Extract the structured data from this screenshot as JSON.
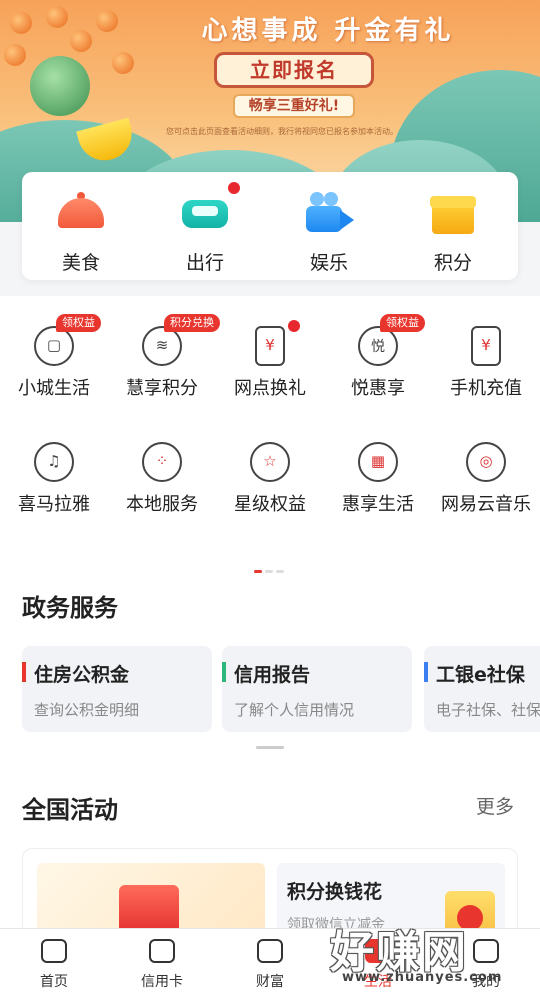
{
  "banner": {
    "title": "心想事成 升金有礼",
    "button": "立即报名",
    "subtitle": "畅享三重好礼!",
    "note": "您可点击此页面查看活动细则，我行将视同您已报名参加本活动。"
  },
  "categories": [
    {
      "label": "美食",
      "icon": "food-dome-icon",
      "color": "#f15a3b"
    },
    {
      "label": "出行",
      "icon": "car-icon",
      "color": "#12b3a6",
      "dot": true
    },
    {
      "label": "娱乐",
      "icon": "video-camera-icon",
      "color": "#1e88f0"
    },
    {
      "label": "积分",
      "icon": "gift-box-icon",
      "color": "#f6aa12"
    }
  ],
  "services": [
    {
      "label": "小城生活",
      "tag": "领权益",
      "icon": "shopping-bag-icon"
    },
    {
      "label": "慧享积分",
      "tag": "积分兑换",
      "icon": "coin-stack-icon"
    },
    {
      "label": "网点换礼",
      "dot": true,
      "icon": "yuan-gift-icon",
      "glyph": "¥"
    },
    {
      "label": "悦惠享",
      "tag": "领权益",
      "icon": "yue-icon",
      "glyph": "悦"
    },
    {
      "label": "手机充值",
      "icon": "phone-yuan-icon",
      "glyph": "¥"
    },
    {
      "label": "喜马拉雅",
      "icon": "headphones-icon"
    },
    {
      "label": "本地服务",
      "icon": "local-grid-icon",
      "glyph": "⁘"
    },
    {
      "label": "星级权益",
      "icon": "star-badge-icon",
      "glyph": "☆"
    },
    {
      "label": "惠享生活",
      "icon": "building-icon",
      "glyph": "▦"
    },
    {
      "label": "网易云音乐",
      "icon": "netease-music-icon",
      "glyph": "◎"
    }
  ],
  "gov": {
    "title": "政务服务",
    "cards": [
      {
        "title": "住房公积金",
        "desc": "查询公积金明细",
        "bar": "#e8362f"
      },
      {
        "title": "信用报告",
        "desc": "了解个人信用情况",
        "bar": "#2fb67a"
      },
      {
        "title": "工银e社保",
        "desc": "电子社保、社保查询",
        "bar": "#3c7df0"
      }
    ]
  },
  "activities": {
    "title": "全国活动",
    "more": "更多",
    "right": {
      "title": "积分换钱花",
      "desc": "领取微信立减金"
    }
  },
  "tabs": [
    {
      "label": "首页",
      "icon": "home-icon"
    },
    {
      "label": "信用卡",
      "icon": "credit-card-icon"
    },
    {
      "label": "财富",
      "icon": "wealth-chart-icon"
    },
    {
      "label": "生活",
      "icon": "life-icon",
      "active": true
    },
    {
      "label": "我的",
      "icon": "profile-icon"
    }
  ],
  "watermark": {
    "big": "好赚网",
    "small": "www.zhuanyes.com"
  }
}
